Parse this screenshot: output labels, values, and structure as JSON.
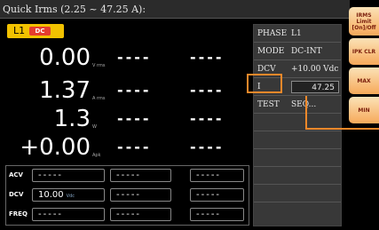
{
  "topbar": {
    "title": "Quick Irms (2.25 ~ 47.25 A):"
  },
  "channel": {
    "label": "L1",
    "mode_badge": "DC"
  },
  "measurements": [
    {
      "value": "0.00",
      "unit": "V rms",
      "col2": "----",
      "col3": "----"
    },
    {
      "value": "1.37",
      "unit": "A rms",
      "col2": "----",
      "col3": "----"
    },
    {
      "value": "1.3",
      "unit": "W",
      "col2": "----",
      "col3": "----"
    },
    {
      "value": "+0.00",
      "unit": "Apk",
      "col2": "----",
      "col3": "----"
    }
  ],
  "bottom_table": {
    "rows": [
      {
        "label": "ACV",
        "cells": [
          {
            "value": "-----",
            "unit": ""
          },
          {
            "value": "-----",
            "unit": ""
          },
          {
            "value": "-----",
            "unit": ""
          }
        ]
      },
      {
        "label": "DCV",
        "cells": [
          {
            "value": "10.00",
            "unit": "Vdc"
          },
          {
            "value": "-----",
            "unit": ""
          },
          {
            "value": "-----",
            "unit": ""
          }
        ]
      },
      {
        "label": "FREQ",
        "cells": [
          {
            "value": "-----",
            "unit": ""
          },
          {
            "value": "-----",
            "unit": ""
          },
          {
            "value": "-----",
            "unit": ""
          }
        ]
      }
    ]
  },
  "params": [
    {
      "key": "PHASE",
      "value": "L1"
    },
    {
      "key": "MODE",
      "value": "DC-INT"
    },
    {
      "key": "DCV",
      "value": "+10.00 Vdc"
    },
    {
      "key": "I",
      "value": "47.25"
    },
    {
      "key": "TEST",
      "value": "SEQ..."
    }
  ],
  "softkeys": [
    {
      "label": "IRMS Limit [On]/Off"
    },
    {
      "label": "IPK CLR"
    },
    {
      "label": "MAX"
    },
    {
      "label": "MIN"
    }
  ],
  "colors": {
    "accent": "#f0882a",
    "channel_tab": "#f2c200",
    "badge": "#e53d2e",
    "softkey": "#f6a95a"
  }
}
